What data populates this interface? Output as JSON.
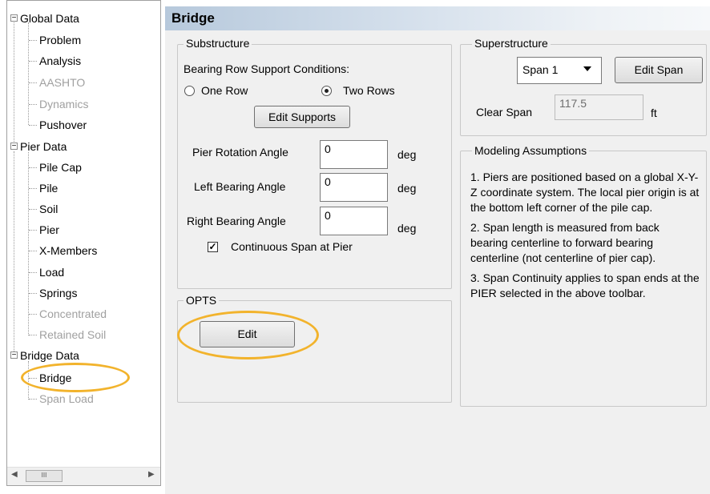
{
  "tree": {
    "nodes": [
      {
        "label": "Global Data",
        "enabled": true
      },
      {
        "label": "Problem",
        "enabled": true
      },
      {
        "label": "Analysis",
        "enabled": true
      },
      {
        "label": "AASHTO",
        "enabled": false
      },
      {
        "label": "Dynamics",
        "enabled": false
      },
      {
        "label": "Pushover",
        "enabled": true
      },
      {
        "label": "Pier Data",
        "enabled": true
      },
      {
        "label": "Pile Cap",
        "enabled": true
      },
      {
        "label": "Pile",
        "enabled": true
      },
      {
        "label": "Soil",
        "enabled": true
      },
      {
        "label": "Pier",
        "enabled": true
      },
      {
        "label": "X-Members",
        "enabled": true
      },
      {
        "label": "Load",
        "enabled": true
      },
      {
        "label": "Springs",
        "enabled": true
      },
      {
        "label": "Concentrated",
        "enabled": false
      },
      {
        "label": "Retained Soil",
        "enabled": false
      },
      {
        "label": "Bridge Data",
        "enabled": true
      },
      {
        "label": "Bridge",
        "enabled": true,
        "selected": true
      },
      {
        "label": "Span Load",
        "enabled": false
      }
    ],
    "expander": "−"
  },
  "scrollbar": {
    "left": "◀",
    "right": "▶",
    "thumb": "III"
  },
  "header": {
    "title": "Bridge"
  },
  "substructure": {
    "legend": "Substructure",
    "bearing_label": "Bearing Row Support Conditions:",
    "radio_one": "One Row",
    "radio_two": "Two Rows",
    "edit_supports": "Edit Supports",
    "pier_rotation_label": "Pier Rotation Angle",
    "pier_rotation_value": "0",
    "left_bearing_label": "Left Bearing Angle",
    "left_bearing_value": "0",
    "right_bearing_label": "Right Bearing Angle",
    "right_bearing_value": "0",
    "unit": "deg",
    "continuous_label": "Continuous Span at Pier"
  },
  "opts": {
    "legend": "OPTS",
    "edit": "Edit"
  },
  "superstructure": {
    "legend": "Superstructure",
    "span_selected": "Span 1",
    "edit_span": "Edit Span",
    "clear_span_label": "Clear Span",
    "clear_span_value": "117.5",
    "unit": "ft"
  },
  "modeling": {
    "legend": "Modeling Assumptions",
    "notes": [
      "1. Piers are positioned based on a global X-Y-Z coordinate system. The local pier origin is at the bottom left corner of the pile cap.",
      "2. Span length is measured from back bearing centerline to forward bearing centerline (not centerline of pier cap).",
      "3. Span Continuity applies to span ends at the PIER selected in the above toolbar."
    ]
  },
  "colors": {
    "highlight_ring": "#f2b32c",
    "header_gradient_start": "#b7c9dc"
  }
}
